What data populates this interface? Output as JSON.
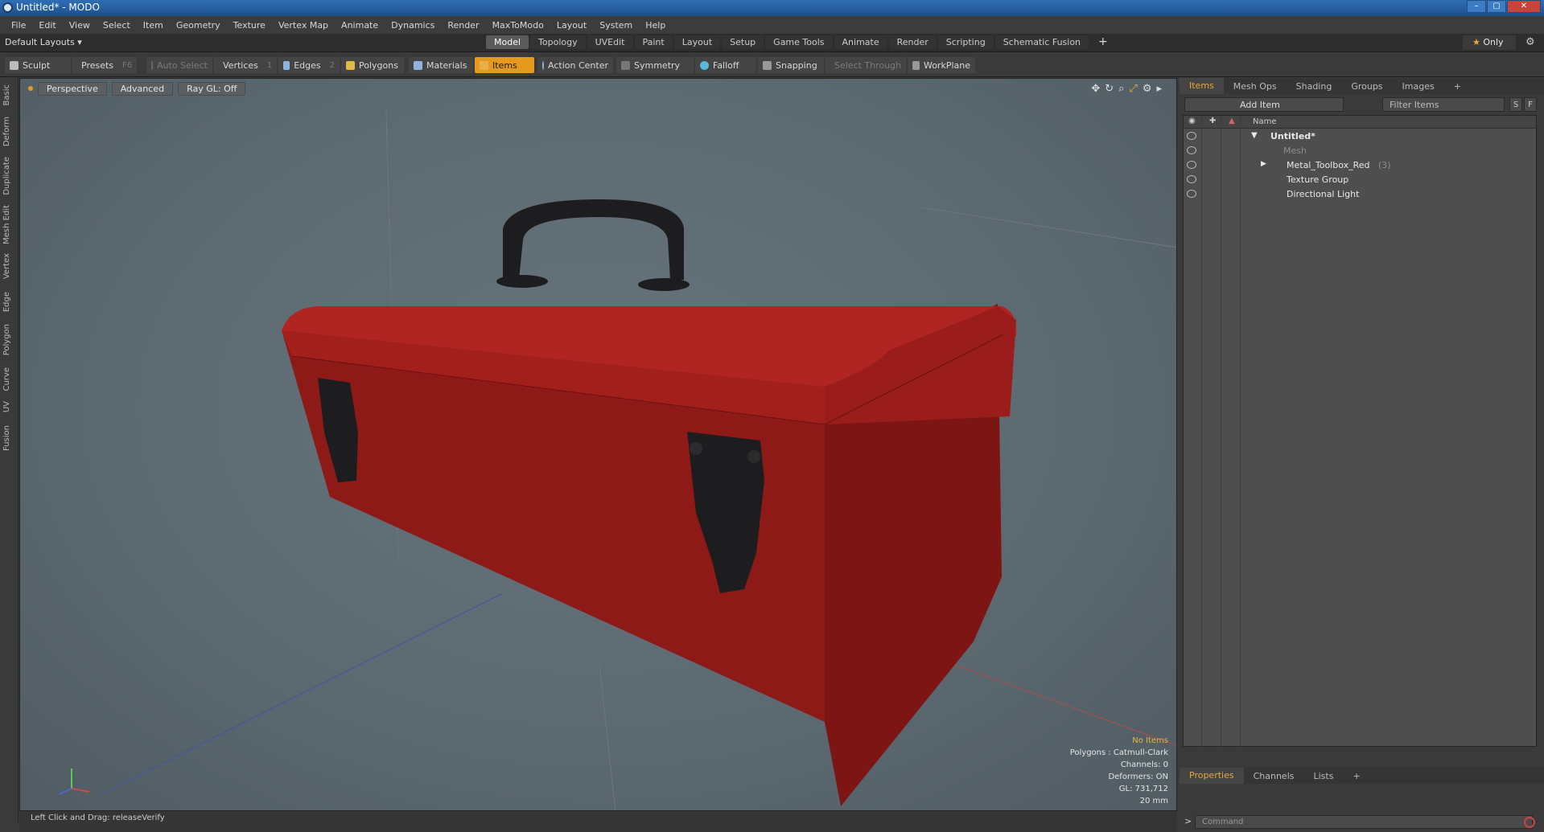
{
  "window": {
    "title": "Untitled* - MODO",
    "min": "–",
    "max": "▢",
    "close": "✕"
  },
  "menu": [
    "File",
    "Edit",
    "View",
    "Select",
    "Item",
    "Geometry",
    "Texture",
    "Vertex Map",
    "Animate",
    "Dynamics",
    "Render",
    "MaxToModo",
    "Layout",
    "System",
    "Help"
  ],
  "layout": {
    "default_layouts": "Default Layouts ▾",
    "tabs": [
      "Model",
      "Topology",
      "UVEdit",
      "Paint",
      "Layout",
      "Setup",
      "Game Tools",
      "Animate",
      "Render",
      "Scripting",
      "Schematic Fusion"
    ],
    "active_tab": "Model",
    "plus": "+",
    "only": "Only",
    "star": "★",
    "gear": "⚙"
  },
  "toolbar": {
    "sculpt": "Sculpt",
    "presets": "Presets",
    "presets_key": "F6",
    "auto_select": "Auto Select",
    "vertices": "Vertices",
    "vertices_num": "1",
    "edges": "Edges",
    "edges_num": "2",
    "polygons": "Polygons",
    "materials": "Materials",
    "items": "Items",
    "action_center": "Action Center",
    "symmetry": "Symmetry",
    "falloff": "Falloff",
    "snapping": "Snapping",
    "select_through": "Select Through",
    "workplane": "WorkPlane"
  },
  "left_tabs": [
    "Basic",
    "Deform",
    "Duplicate",
    "Mesh Edit",
    "Vertex",
    "Edge",
    "Polygon",
    "Curve",
    "UV",
    "Fusion"
  ],
  "viewport": {
    "perspective": "Perspective",
    "advanced": "Advanced",
    "raygl": "Ray GL: Off",
    "stats": {
      "no_items": "No Items",
      "polygons": "Polygons : Catmull-Clark",
      "channels": "Channels: 0",
      "deformers": "Deformers: ON",
      "gl": "GL: 731,712",
      "scale": "20 mm"
    },
    "icons": [
      "move-icon",
      "rotate-icon",
      "zoom-icon",
      "fit-icon",
      "settings-icon",
      "arrow-icon"
    ],
    "body_color": "#a31f1c",
    "lid_color": "#b02421",
    "hardware_color": "#1d1d1f"
  },
  "status": {
    "text": "Left Click and Drag:   releaseVerify"
  },
  "right_panel": {
    "tabs": [
      "Items",
      "Mesh Ops",
      "Shading",
      "Groups",
      "Images",
      "+"
    ],
    "add_item": "Add Item",
    "filter": "Filter Items",
    "s_btn": "S",
    "f_btn": "F",
    "name_header": "Name",
    "tree": [
      {
        "label": "Untitled*",
        "indent": 0
      },
      {
        "label": "Mesh",
        "indent": 1
      },
      {
        "label": "Metal_Toolbox_Red",
        "count": "(3)",
        "indent": 1
      },
      {
        "label": "Texture Group",
        "indent": 1
      },
      {
        "label": "Directional Light",
        "indent": 1
      }
    ],
    "prop_tabs": [
      "Properties",
      "Channels",
      "Lists",
      "+"
    ],
    "command_placeholder": "Command",
    "command_prompt": ">"
  },
  "accent": "#e59a1f"
}
